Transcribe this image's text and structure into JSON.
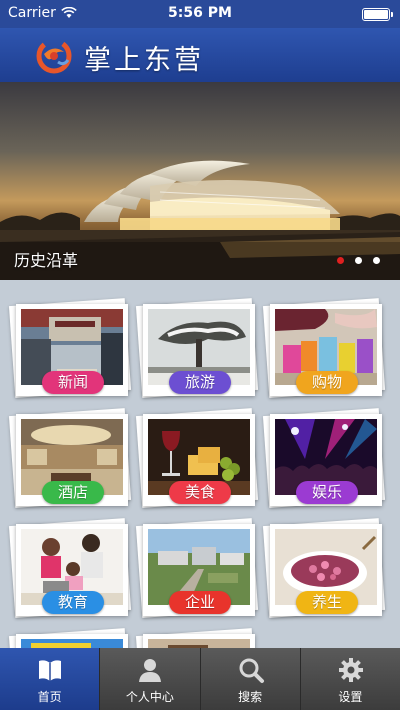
{
  "status_bar": {
    "carrier": "Carrier",
    "time": "5:56 PM"
  },
  "header": {
    "title": "掌上东营",
    "logo_icon": "swirl-logo-icon"
  },
  "banner": {
    "caption": "历史沿革",
    "dots": 3,
    "active_dot": 1
  },
  "categories": [
    {
      "label": "新闻",
      "color": "#e2347a",
      "icon": "news-center-photo"
    },
    {
      "label": "旅游",
      "color": "#6c4fd2",
      "icon": "snowy-tree-photo"
    },
    {
      "label": "购物",
      "color": "#f0a51e",
      "icon": "shopping-bags-photo"
    },
    {
      "label": "酒店",
      "color": "#39b94a",
      "icon": "hotel-lobby-photo"
    },
    {
      "label": "美食",
      "color": "#ee3a48",
      "icon": "food-wine-photo"
    },
    {
      "label": "娱乐",
      "color": "#9b3bd2",
      "icon": "concert-crowd-photo"
    },
    {
      "label": "教育",
      "color": "#2a8fe4",
      "icon": "family-laptop-photo"
    },
    {
      "label": "企业",
      "color": "#e8342c",
      "icon": "industrial-park-photo"
    },
    {
      "label": "养生",
      "color": "#f0b514",
      "icon": "flower-tea-photo"
    }
  ],
  "tab_bar": {
    "tabs": [
      {
        "label": "首页",
        "icon": "book-icon",
        "active": true
      },
      {
        "label": "个人中心",
        "icon": "person-icon",
        "active": false
      },
      {
        "label": "搜索",
        "icon": "search-icon",
        "active": false
      },
      {
        "label": "设置",
        "icon": "gear-icon",
        "active": false
      }
    ]
  }
}
